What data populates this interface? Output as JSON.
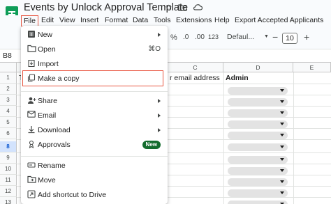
{
  "window": {
    "title": "Events by Unlock Approval Template"
  },
  "title_icons": [
    "star-icon",
    "move-to-folder-icon",
    "cloud-status-icon"
  ],
  "menubar": {
    "items": [
      "File",
      "Edit",
      "View",
      "Insert",
      "Format",
      "Data",
      "Tools",
      "Extensions",
      "Help",
      "Export Accepted Applicants"
    ]
  },
  "toolbar": {
    "format_number": "123",
    "font_name": "Defaul...",
    "font_size": "10",
    "decrease_font": "−",
    "increase_font": "+"
  },
  "formula_bar": {
    "name_box": "B8"
  },
  "grid": {
    "column_headers": [
      "C",
      "D",
      "E"
    ],
    "row_headers": [
      "1",
      "2",
      "3",
      "4",
      "5",
      "6",
      "7",
      "8",
      "9",
      "10",
      "11",
      "12",
      "13"
    ],
    "active_row": "8",
    "row1": {
      "a_partial": "T",
      "c_partial": "r email address",
      "d": "Admin"
    }
  },
  "file_menu": {
    "items": [
      {
        "label": "New",
        "icon": "new-sheet-icon",
        "submenu": true
      },
      {
        "label": "Open",
        "icon": "folder-open-icon",
        "shortcut": "⌘O"
      },
      {
        "label": "Import",
        "icon": "import-icon"
      },
      {
        "label": "Make a copy",
        "icon": "copy-icon",
        "highlighted": true
      },
      {
        "label": "Share",
        "icon": "share-person-icon",
        "submenu": true
      },
      {
        "label": "Email",
        "icon": "email-icon",
        "submenu": true
      },
      {
        "label": "Download",
        "icon": "download-icon",
        "submenu": true
      },
      {
        "label": "Approvals",
        "icon": "approvals-icon",
        "badge": "New"
      },
      {
        "label": "Rename",
        "icon": "rename-icon"
      },
      {
        "label": "Move",
        "icon": "move-folder-icon"
      },
      {
        "label": "Add shortcut to Drive",
        "icon": "drive-shortcut-icon"
      }
    ]
  },
  "colors": {
    "highlight_border": "#e8553f",
    "sheets_green": "#0f9d58",
    "badge_green": "#146c2e",
    "active_row_bg": "#d3e3fd"
  }
}
